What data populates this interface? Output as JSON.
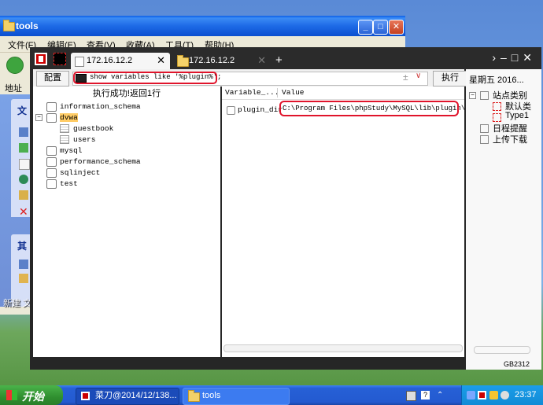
{
  "explorer": {
    "title": "tools",
    "menu": [
      "文件(F)",
      "编辑(E)",
      "查看(V)",
      "收藏(A)",
      "工具(T)",
      "帮助(H)"
    ],
    "address_label": "地址",
    "tasks_head_1": "文",
    "tasks_head_2": "其",
    "desktop_icon_label": "新建 文本文档.txt"
  },
  "app": {
    "tabs": [
      {
        "label": "172.16.12.2",
        "active": true
      },
      {
        "label": "172.16.12.2",
        "active": false
      }
    ],
    "new_tab_label": "+",
    "config_button": "配置",
    "sql_query": "show variables like '%plugin%';",
    "execute_button": "执行",
    "status_text": "执行成功!返回1行",
    "databases": [
      {
        "name": "information_schema",
        "expanded": false
      },
      {
        "name": "dvwa",
        "expanded": true,
        "tables": [
          "guestbook",
          "users"
        ]
      },
      {
        "name": "mysql",
        "expanded": false
      },
      {
        "name": "performance_schema",
        "expanded": false
      },
      {
        "name": "sqlinject",
        "expanded": false
      },
      {
        "name": "test",
        "expanded": false
      }
    ],
    "result": {
      "columns": [
        "Variable_...",
        "Value"
      ],
      "rows": [
        [
          "plugin_dir",
          "C:\\Program Files\\phpStudy\\MySQL\\lib\\plugin\\"
        ]
      ]
    },
    "side": {
      "date": "星期五 2016...",
      "items": [
        "站点类别",
        "默认类",
        "Type1",
        "日程提醒",
        "上传下载"
      ]
    },
    "encoding": "GB2312"
  },
  "taskbar": {
    "start_label": "开始",
    "tasks": [
      {
        "label": "菜刀@2014/12/138...",
        "active": false
      },
      {
        "label": "tools",
        "active": true
      }
    ],
    "clock": "23:37"
  },
  "colors": {
    "highlight": "#e0142b",
    "app_bg": "#262626",
    "taskbar": "#245ad0"
  }
}
